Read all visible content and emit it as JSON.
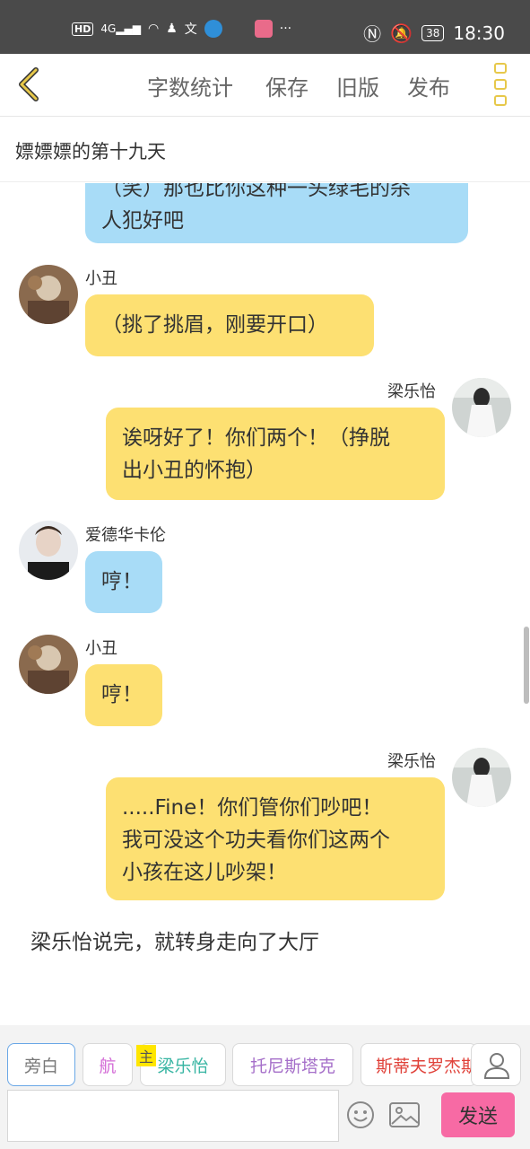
{
  "status_bar": {
    "hd_badge": "HD",
    "network": "4G",
    "battery": "38",
    "time": "18:30",
    "icons": [
      "signal-icon",
      "wifi-icon",
      "qq-icon",
      "translate-icon",
      "app-icon",
      "more-dots-icon",
      "nfc-icon",
      "mute-bell-icon",
      "battery-icon"
    ]
  },
  "toolbar": {
    "word_count": "字数统计",
    "save": "保存",
    "old_version": "旧版",
    "publish": "发布"
  },
  "chapter_title": "嫖嫖嫖的第十九天",
  "messages": [
    {
      "speaker": "",
      "side": "left",
      "color": "blue",
      "text": [
        "（笑）那也比你这种一头绿毛的杀",
        "人犯好吧"
      ]
    },
    {
      "speaker": "小丑",
      "side": "left",
      "color": "yellow",
      "text": [
        "（挑了挑眉，刚要开口）"
      ]
    },
    {
      "speaker": "梁乐怡",
      "side": "right",
      "color": "yellow",
      "text": [
        "诶呀好了！你们两个！（挣脱",
        "出小丑的怀抱）"
      ]
    },
    {
      "speaker": "爱德华卡伦",
      "side": "left",
      "color": "blue",
      "text": [
        "哼！"
      ]
    },
    {
      "speaker": "小丑",
      "side": "left",
      "color": "yellow",
      "text": [
        "哼！"
      ]
    },
    {
      "speaker": "梁乐怡",
      "side": "right",
      "color": "yellow",
      "text": [
        ".....Fine！你们管你们吵吧！",
        "我可没这个功夫看你们这两个",
        "小孩在这儿吵架！"
      ]
    }
  ],
  "narration": "梁乐怡说完，就转身走向了大厅",
  "roles": {
    "aside": "旁白",
    "hang": "航",
    "main_tag": "主",
    "liang": "梁乐怡",
    "tony": "托尼斯塔克",
    "steve": "斯蒂夫罗杰斯"
  },
  "input": {
    "value": "",
    "placeholder": ""
  },
  "send": "发送",
  "colors": {
    "accent_yellow": "#fde072",
    "bubble_blue": "#a8dcf7",
    "send_pink": "#f76aa4"
  }
}
